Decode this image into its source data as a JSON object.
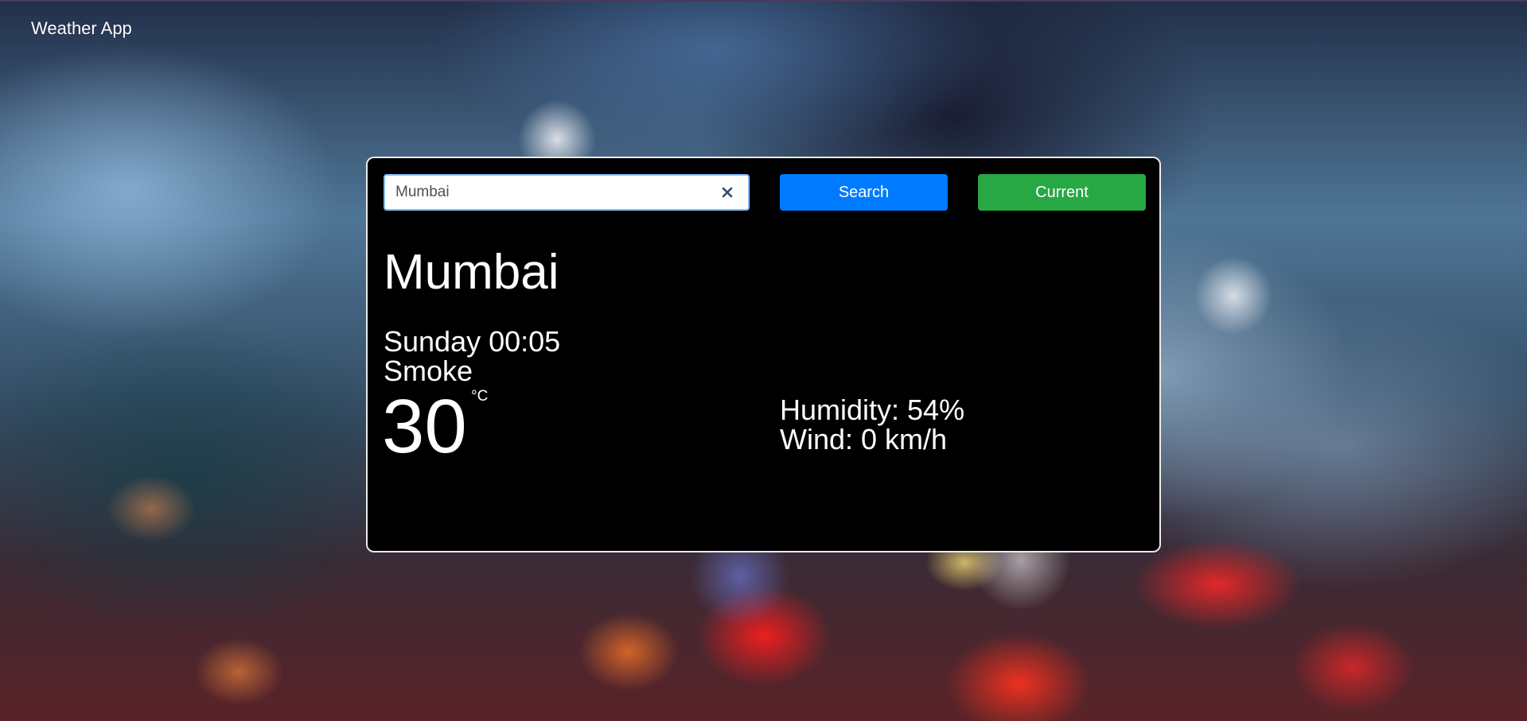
{
  "app": {
    "title": "Weather App"
  },
  "search": {
    "value": "Mumbai",
    "clear_icon": "close-icon",
    "search_label": "Search",
    "current_label": "Current"
  },
  "colors": {
    "search_button": "#007bff",
    "current_button": "#28a745",
    "card_background": "#000000",
    "text": "#ffffff"
  },
  "weather": {
    "city": "Mumbai",
    "day_time": "Sunday 00:05",
    "condition": "Smoke",
    "temperature": "30",
    "unit": "°C",
    "humidity_text": "Humidity: 54%",
    "wind_text": "Wind: 0 km/h"
  }
}
